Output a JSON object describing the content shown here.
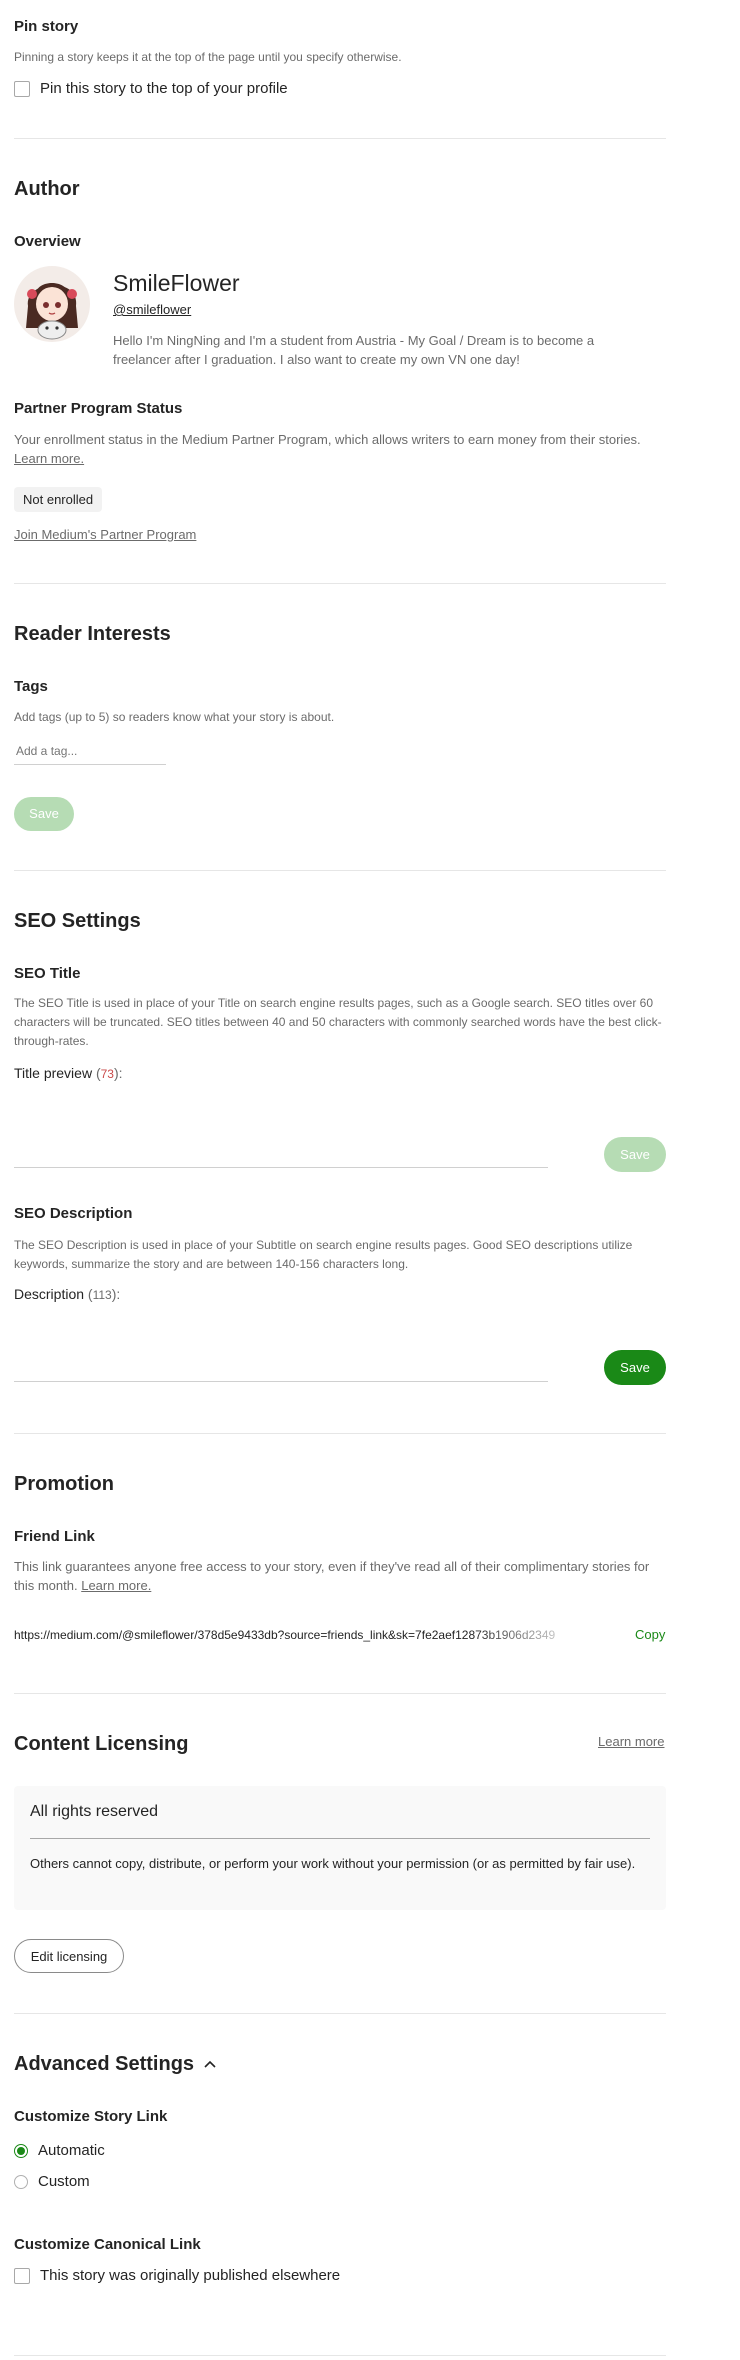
{
  "pin": {
    "title": "Pin story",
    "desc": "Pinning a story keeps it at the top of the page until you specify otherwise.",
    "checkbox_label": "Pin this story to the top of your profile"
  },
  "author": {
    "section_title": "Author",
    "overview_title": "Overview",
    "name": "SmileFlower",
    "handle": "@smileflower",
    "bio": "Hello I'm NingNing and I'm a student from Austria - My Goal / Dream is to become a freelancer after I graduation. I also want to create my own VN one day!",
    "partner_title": "Partner Program Status",
    "partner_desc": "Your enrollment status in the Medium Partner Program, which allows writers to earn money from their stories.",
    "partner_learn_more": "Learn more.",
    "status_badge": "Not enrolled",
    "join_link": "Join Medium's Partner Program"
  },
  "reader": {
    "section_title": "Reader Interests",
    "tags_title": "Tags",
    "tags_desc": "Add tags (up to 5) so readers know what your story is about.",
    "tags_placeholder": "Add a tag...",
    "save_label": "Save"
  },
  "seo": {
    "section_title": "SEO Settings",
    "title_heading": "SEO Title",
    "title_desc": "The SEO Title is used in place of your Title on search engine results pages, such as a Google search. SEO titles over 60 characters will be truncated. SEO titles between 40 and 50 characters with commonly searched words have the best click-through-rates.",
    "title_preview_label": "Title preview",
    "title_preview_count": "73",
    "title_save": "Save",
    "desc_heading": "SEO Description",
    "desc_desc": "The SEO Description is used in place of your Subtitle on search engine results pages. Good SEO descriptions utilize keywords, summarize the story and are between 140-156 characters long.",
    "desc_label": "Description",
    "desc_count": "113",
    "desc_save": "Save"
  },
  "promotion": {
    "section_title": "Promotion",
    "friend_title": "Friend Link",
    "friend_desc": "This link guarantees anyone free access to your story, even if they've read all of their complimentary stories for this month.",
    "friend_learn_more": "Learn more.",
    "friend_url": "https://medium.com/@smileflower/378d5e9433db?source=friends_link&sk=7fe2aef12873b1906d2349",
    "copy_label": "Copy"
  },
  "licensing": {
    "section_title": "Content Licensing",
    "learn_more": "Learn more",
    "card_title": "All rights reserved",
    "card_desc": "Others cannot copy, distribute, or perform your work without your permission (or as permitted by fair use).",
    "edit_label": "Edit licensing"
  },
  "advanced": {
    "section_title": "Advanced Settings",
    "story_link_title": "Customize Story Link",
    "option_automatic": "Automatic",
    "option_custom": "Custom",
    "canonical_title": "Customize Canonical Link",
    "canonical_checkbox": "This story was originally published elsewhere"
  },
  "colors": {
    "accent_green": "#1a8917",
    "disabled_green": "#b6dcb4",
    "count_red": "#c94a4a"
  }
}
